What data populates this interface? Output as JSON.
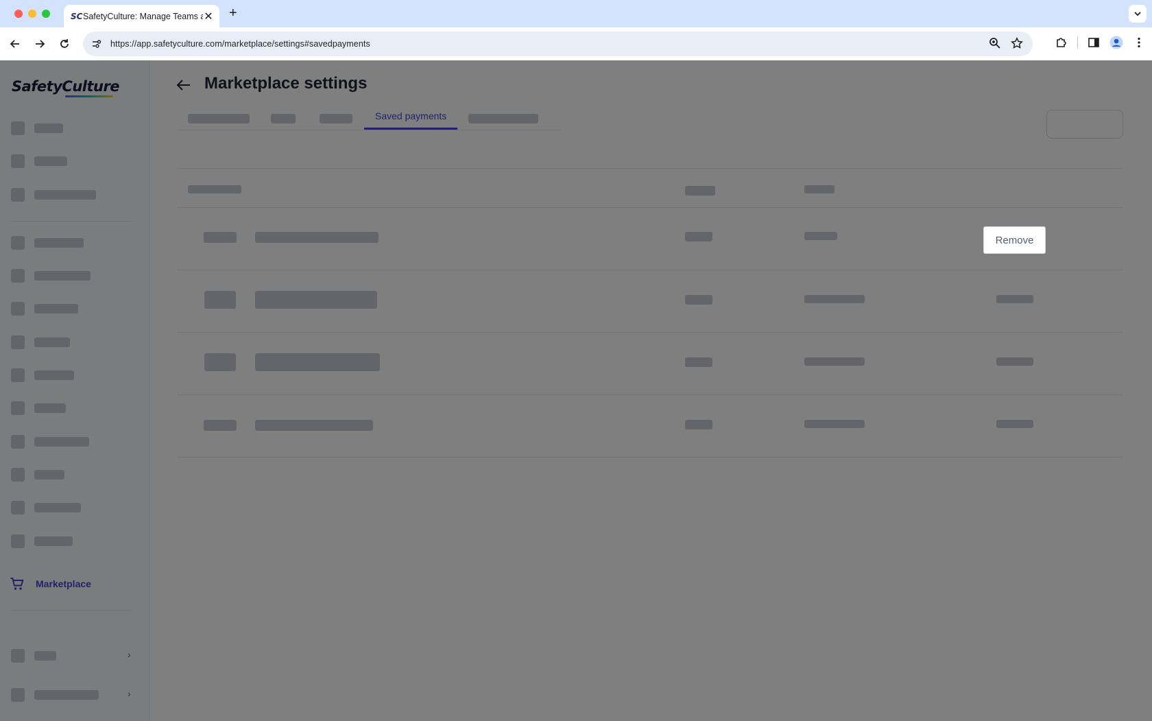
{
  "browser": {
    "tab_favicon": "SC",
    "tab_title": "SafetyCulture: Manage Teams and...",
    "tab_close": "✕",
    "new_tab": "+",
    "url": "https://app.safetyculture.com/marketplace/settings#savedpayments"
  },
  "sidebar": {
    "logo": "SafetyCulture",
    "active_item": "Marketplace"
  },
  "main": {
    "title": "Marketplace settings",
    "active_tab": "Saved payments"
  },
  "row_actions": {
    "remove_label": "Remove"
  },
  "colors": {
    "accent": "#4740d4",
    "overlay": "rgba(0,0,0,0.5)",
    "browser_frame": "#d3e3fd"
  }
}
